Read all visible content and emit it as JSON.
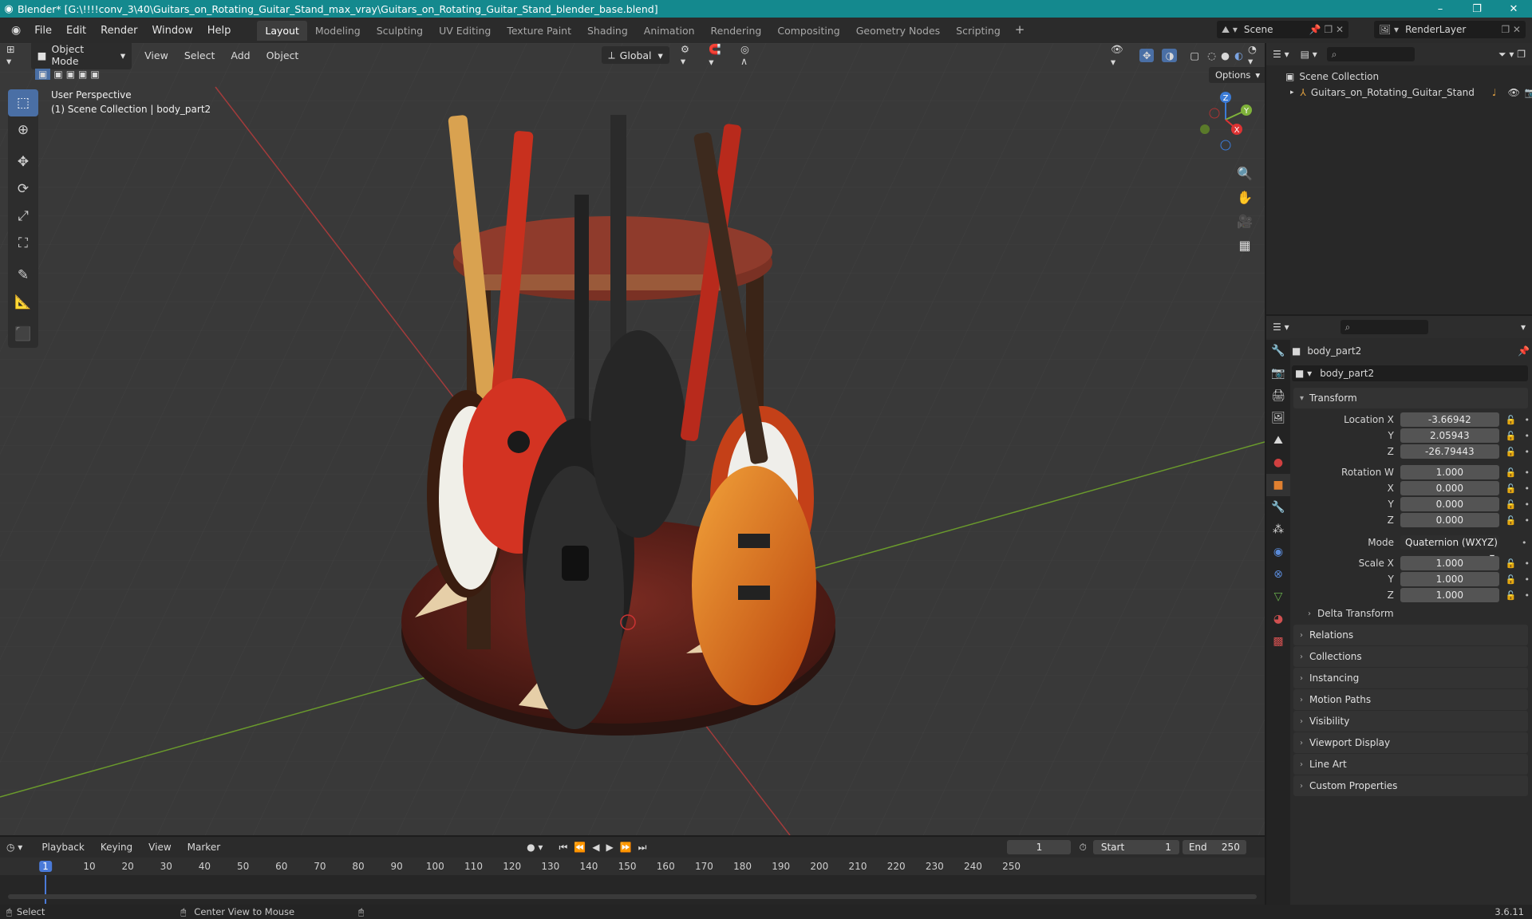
{
  "window": {
    "title": "Blender* [G:\\!!!!conv_3\\40\\Guitars_on_Rotating_Guitar_Stand_max_vray\\Guitars_on_Rotating_Guitar_Stand_blender_base.blend]",
    "minimize": "–",
    "maximize": "❐",
    "close": "✕"
  },
  "menu": [
    "File",
    "Edit",
    "Render",
    "Window",
    "Help"
  ],
  "workspaces": [
    "Layout",
    "Modeling",
    "Sculpting",
    "UV Editing",
    "Texture Paint",
    "Shading",
    "Animation",
    "Rendering",
    "Compositing",
    "Geometry Nodes",
    "Scripting"
  ],
  "workspace_add": "+",
  "scene": "Scene",
  "view_layer": "RenderLayer",
  "viewport": {
    "mode": "Object Mode",
    "menus": [
      "View",
      "Select",
      "Add",
      "Object"
    ],
    "orientation": "Global",
    "options": "Options",
    "overlay_line1": "User Perspective",
    "overlay_line2": "(1) Scene Collection | body_part2",
    "gizmo": {
      "z": "Z",
      "y": "Y",
      "x": "X"
    }
  },
  "outliner": {
    "root": "Scene Collection",
    "items": [
      {
        "label": "Guitars_on_Rotating_Guitar_Stand"
      }
    ]
  },
  "properties": {
    "object_name": "body_part2",
    "data_name": "body_part2",
    "transform_label": "Transform",
    "location": [
      {
        "label": "Location X",
        "value": "-3.66942"
      },
      {
        "label": "Y",
        "value": "2.05943"
      },
      {
        "label": "Z",
        "value": "-26.79443"
      }
    ],
    "rotation": [
      {
        "label": "Rotation W",
        "value": "1.000"
      },
      {
        "label": "X",
        "value": "0.000"
      },
      {
        "label": "Y",
        "value": "0.000"
      },
      {
        "label": "Z",
        "value": "0.000"
      }
    ],
    "mode_label": "Mode",
    "mode_value": "Quaternion (WXYZ)",
    "scale": [
      {
        "label": "Scale X",
        "value": "1.000"
      },
      {
        "label": "Y",
        "value": "1.000"
      },
      {
        "label": "Z",
        "value": "1.000"
      }
    ],
    "delta_transform": "Delta Transform",
    "sections": [
      "Relations",
      "Collections",
      "Instancing",
      "Motion Paths",
      "Visibility",
      "Viewport Display",
      "Line Art",
      "Custom Properties"
    ]
  },
  "timeline": {
    "menus": [
      "Playback",
      "Keying",
      "View",
      "Marker"
    ],
    "current_frame": "1",
    "start_label": "Start",
    "start": "1",
    "end_label": "End",
    "end": "250",
    "ruler": [
      "1",
      "10",
      "20",
      "30",
      "40",
      "50",
      "60",
      "70",
      "80",
      "90",
      "100",
      "110",
      "120",
      "130",
      "140",
      "150",
      "160",
      "170",
      "180",
      "190",
      "200",
      "210",
      "220",
      "230",
      "240",
      "250"
    ]
  },
  "status": {
    "left": "Select",
    "center": "Center View to Mouse",
    "version": "3.6.11"
  }
}
